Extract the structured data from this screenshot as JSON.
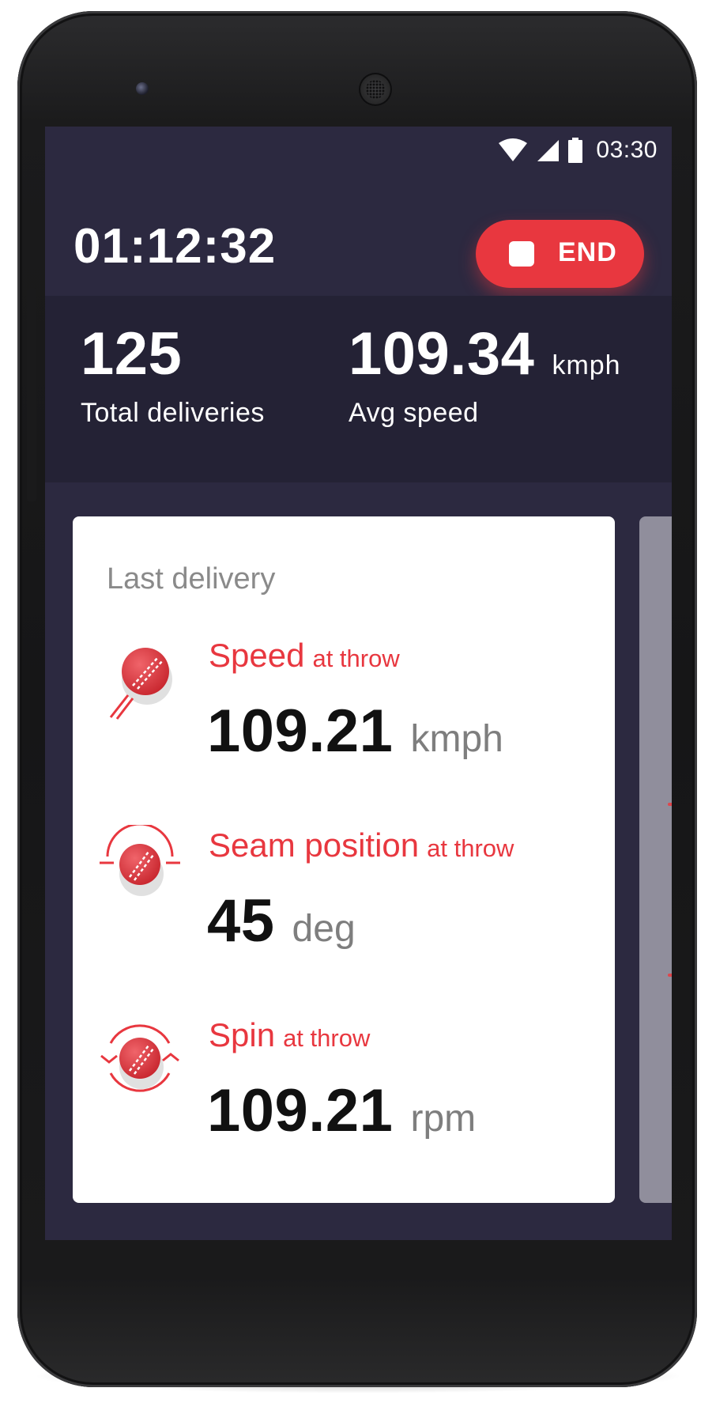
{
  "status_bar": {
    "time": "03:30",
    "icons": [
      "wifi-icon",
      "cell-signal-icon",
      "battery-icon"
    ]
  },
  "header": {
    "timer": "01:12:32",
    "end_label": "END"
  },
  "stats": {
    "total_deliveries": {
      "value": "125",
      "label": "Total deliveries"
    },
    "avg_speed": {
      "value": "109.34",
      "unit": "kmph",
      "label": "Avg speed"
    }
  },
  "card": {
    "title": "Last delivery",
    "metrics": [
      {
        "name": "Speed",
        "suffix": "at throw",
        "value": "109.21",
        "unit": "kmph",
        "icon": "speed-ball-icon"
      },
      {
        "name": "Seam position",
        "suffix": "at throw",
        "value": "45",
        "unit": "deg",
        "icon": "seam-ball-icon"
      },
      {
        "name": "Spin",
        "suffix": "at throw",
        "value": "109.21",
        "unit": "rpm",
        "icon": "spin-ball-icon"
      }
    ]
  },
  "colors": {
    "accent": "#e8373f",
    "screen_bg": "#2c2940",
    "stats_bg": "#242235",
    "card_bg": "#ffffff",
    "next_card_bg": "#908e9c"
  }
}
